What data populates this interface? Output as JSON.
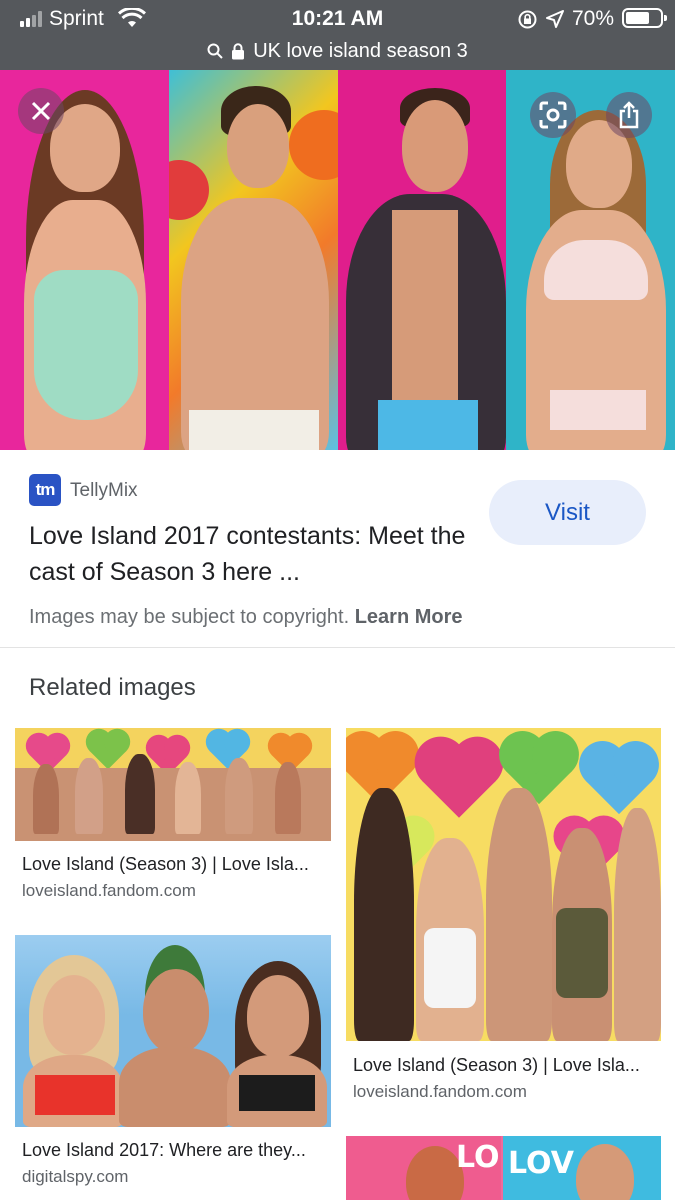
{
  "status": {
    "carrier": "Sprint",
    "time": "10:21 AM",
    "battery": "70%",
    "battery_level": 0.7
  },
  "url_bar": {
    "query": "UK love island season 3"
  },
  "hero": {
    "close_icon": "close-icon",
    "lens_icon": "lens-icon",
    "share_icon": "share-icon"
  },
  "result": {
    "source_logo": "tm",
    "source_name": "TellyMix",
    "title": "Love Island 2017 contestants: Meet the cast of Season 3 here ...",
    "visit_label": "Visit",
    "copyright_text": "Images may be subject to copyright.",
    "learn_more": "Learn More"
  },
  "related": {
    "heading": "Related images",
    "items": [
      {
        "caption": "Love Island (Season 3) | Love Isla...",
        "source": "loveisland.fandom.com"
      },
      {
        "caption": "Love Island (Season 3) | Love Isla...",
        "source": "loveisland.fandom.com"
      },
      {
        "caption": "Love Island 2017: Where are they...",
        "source": "digitalspy.com"
      }
    ]
  },
  "colors": {
    "status_bg": "#55585c",
    "visit_bg": "#e8eefb",
    "visit_text": "#1a57c5",
    "tellymix_logo": "#2a53c4"
  }
}
